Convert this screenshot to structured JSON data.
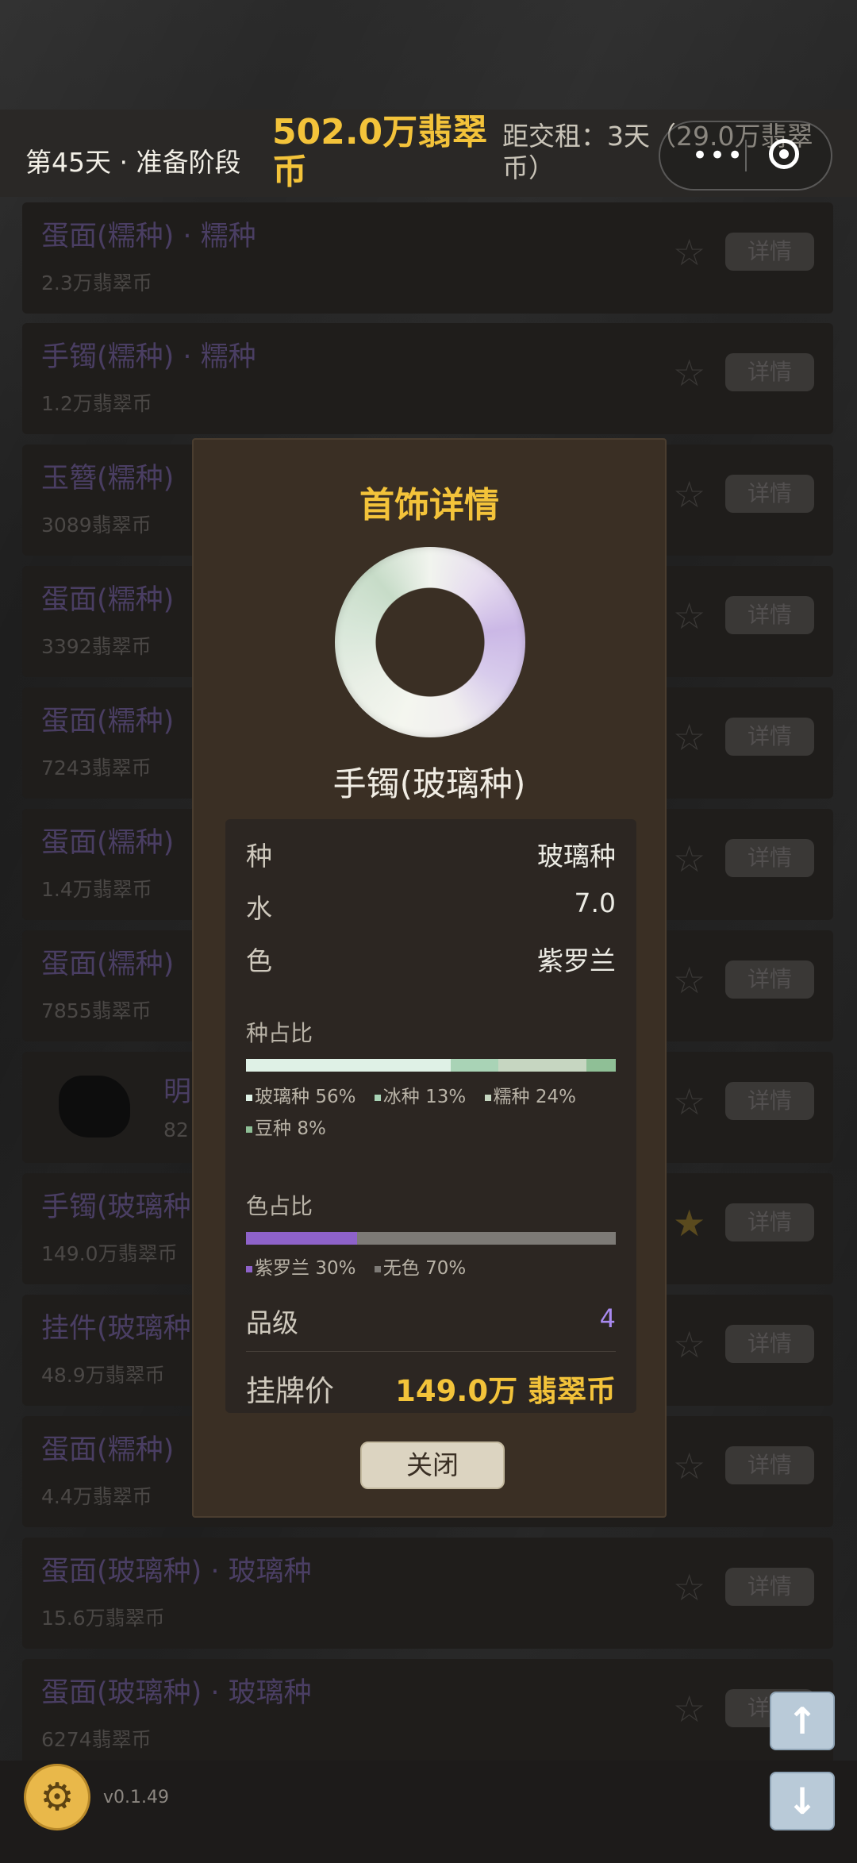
{
  "header": {
    "day_phase": "第45天 · 准备阶段",
    "money": "502.0万翡翠币",
    "rent": "距交租：3天（29.0万翡翠币）"
  },
  "capsule": {
    "more": "•••",
    "target_icon": "target-icon"
  },
  "list": [
    {
      "name": "蛋面(糯种) · 糯种",
      "price": "2.3万翡翠币",
      "detail": "详情"
    },
    {
      "name": "手镯(糯种) · 糯种",
      "price": "1.2万翡翠币",
      "detail": "详情"
    },
    {
      "name": "玉簪(糯种)",
      "price": "3089翡翠币",
      "detail": "详情"
    },
    {
      "name": "蛋面(糯种)",
      "price": "3392翡翠币",
      "detail": "详情"
    },
    {
      "name": "蛋面(糯种)",
      "price": "7243翡翠币",
      "detail": "详情"
    },
    {
      "name": "蛋面(糯种)",
      "price": "1.4万翡翠币",
      "detail": "详情"
    },
    {
      "name": "蛋面(糯种)",
      "price": "7855翡翠币",
      "detail": "详情"
    },
    {
      "name": "明",
      "price": "82",
      "detail": "详情"
    },
    {
      "name": "手镯(玻璃种",
      "price": "149.0万翡翠币",
      "detail": "详情"
    },
    {
      "name": "挂件(玻璃种",
      "price": "48.9万翡翠币",
      "detail": "详情"
    },
    {
      "name": "蛋面(糯种)",
      "price": "4.4万翡翠币",
      "detail": "详情"
    },
    {
      "name": "蛋面(玻璃种) · 玻璃种",
      "price": "15.6万翡翠币",
      "detail": "详情"
    },
    {
      "name": "蛋面(玻璃种) · 玻璃种",
      "price": "6274翡翠币",
      "detail": "详情"
    }
  ],
  "modal": {
    "title": "首饰详情",
    "item_name": "手镯(玻璃种)",
    "zhong_label": "种",
    "zhong_value": "玻璃种",
    "shui_label": "水",
    "shui_value": "7.0",
    "se_label": "色",
    "se_value": "紫罗兰",
    "zhong_ratio_label": "种占比",
    "zhong_ratio": [
      {
        "name": "玻璃种",
        "pct": "56%",
        "value": 56,
        "color": "#dff1e6"
      },
      {
        "name": "冰种",
        "pct": "13%",
        "value": 13,
        "color": "#a9d3b6"
      },
      {
        "name": "糯种",
        "pct": "24%",
        "value": 24,
        "color": "#c6d6c1"
      },
      {
        "name": "豆种",
        "pct": "8%",
        "value": 8,
        "color": "#8fbf96"
      }
    ],
    "se_ratio_label": "色占比",
    "se_ratio": [
      {
        "name": "紫罗兰",
        "pct": "30%",
        "value": 30,
        "color": "#8e62c9"
      },
      {
        "name": "无色",
        "pct": "70%",
        "value": 70,
        "color": "#7d7a76"
      }
    ],
    "grade_label": "品级",
    "grade_value": "4",
    "price_label": "挂牌价",
    "price_value": "149.0万 翡翠币",
    "close_label": "关闭"
  },
  "footer": {
    "version": "v0.1.49"
  }
}
